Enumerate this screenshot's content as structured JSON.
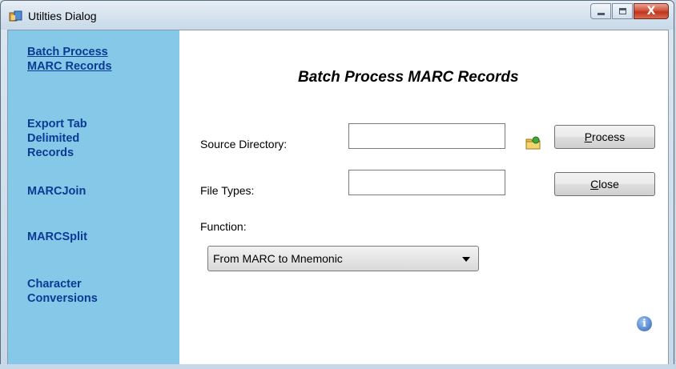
{
  "window": {
    "title": "Utilties Dialog",
    "close_glyph": "X"
  },
  "sidebar": {
    "items": [
      {
        "label": "Batch Process\nMARC Records",
        "active": true
      },
      {
        "label": "Export Tab\nDelimited\nRecords"
      },
      {
        "label": "MARCJoin"
      },
      {
        "label": "MARCSplit"
      },
      {
        "label": "Character\nConversions"
      }
    ]
  },
  "main": {
    "title": "Batch Process MARC Records",
    "source_directory": {
      "label": "Source Directory:",
      "value": ""
    },
    "file_types": {
      "label": "File Types:",
      "value": ""
    },
    "function": {
      "label": "Function:",
      "selected": "From MARC to Mnemonic"
    },
    "buttons": {
      "process": {
        "accel": "P",
        "rest": "rocess"
      },
      "close": {
        "accel": "C",
        "rest": "lose"
      }
    },
    "info_glyph": "i"
  },
  "icons": {
    "app": "app-icon",
    "folder": "folder-browse-icon",
    "info": "info-icon"
  },
  "colors": {
    "sidebar_bg": "#86c8e8",
    "link": "#0b3a93",
    "close_button": "#c0351d"
  }
}
